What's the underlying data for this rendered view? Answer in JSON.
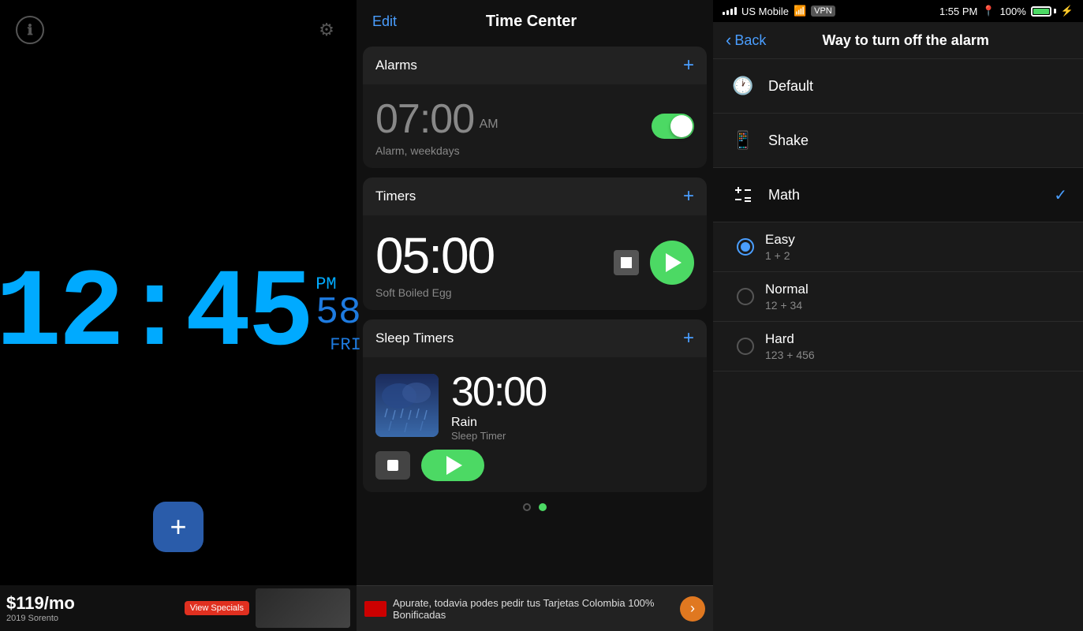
{
  "left": {
    "time": "12:45",
    "seconds": "58",
    "ampm": "PM",
    "day": "FRI",
    "info_icon": "ℹ",
    "gear_icon": "⚙",
    "add_label": "+",
    "ad": {
      "brand": "2019 Sorento",
      "price": "$119/mo",
      "cta": "View Specials"
    }
  },
  "center": {
    "edit_label": "Edit",
    "title": "Time Center",
    "sections": {
      "alarms": {
        "label": "Alarms",
        "add": "+",
        "item": {
          "time": "07:00",
          "ampm": "AM",
          "sub": "Alarm, weekdays",
          "toggle": true
        }
      },
      "timers": {
        "label": "Timers",
        "add": "+",
        "item": {
          "time": "05:00",
          "sub": "Soft Boiled Egg"
        }
      },
      "sleep": {
        "label": "Sleep Timers",
        "add": "+",
        "item": {
          "time": "30:00",
          "title": "Rain",
          "sub": "Sleep Timer"
        }
      }
    },
    "dots": [
      "circle-only",
      "active"
    ],
    "ad": {
      "text": "Apurate, todavia podes pedir tus Tarjetas Colombia 100% Bonificadas",
      "arrow": "›"
    }
  },
  "right": {
    "status": {
      "carrier": "US Mobile",
      "wifi": true,
      "vpn": "VPN",
      "time": "1:55 PM",
      "battery": "100%"
    },
    "back_label": "Back",
    "page_title": "Way to turn off the alarm",
    "options": [
      {
        "id": "default",
        "icon": "🕐",
        "label": "Default",
        "selected": false,
        "has_check": false
      },
      {
        "id": "shake",
        "icon": "📱",
        "label": "Shake",
        "selected": false,
        "has_check": false
      },
      {
        "id": "math",
        "icon": "±",
        "label": "Math",
        "selected": true,
        "has_check": true,
        "sub_options": [
          {
            "id": "easy",
            "label": "Easy",
            "desc": "1 + 2",
            "selected": true
          },
          {
            "id": "normal",
            "label": "Normal",
            "desc": "12 + 34",
            "selected": false
          },
          {
            "id": "hard",
            "label": "Hard",
            "desc": "123 + 456",
            "selected": false
          }
        ]
      }
    ]
  }
}
